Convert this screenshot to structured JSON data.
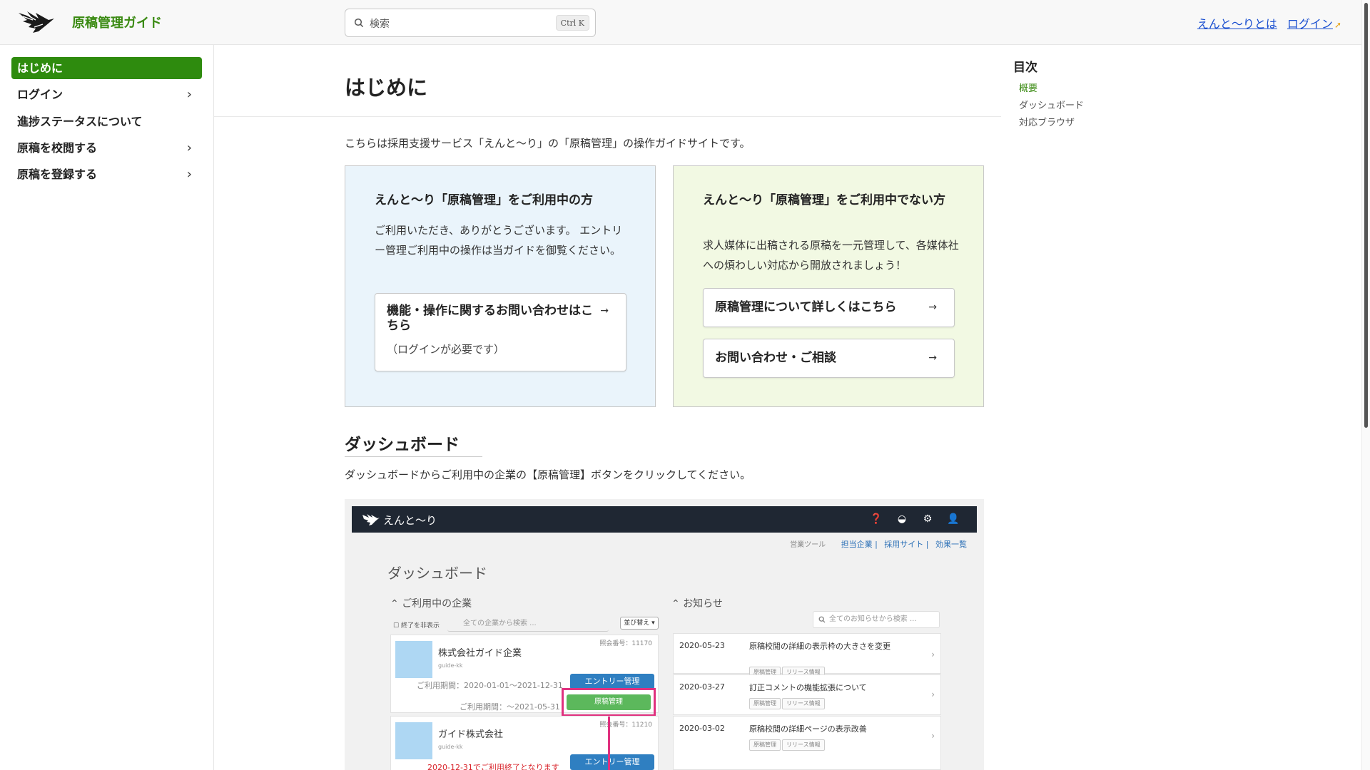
{
  "header": {
    "site_title": "原稿管理ガイド",
    "search_placeholder": "検索",
    "search_shortcut": "Ctrl K",
    "links": [
      "えんと〜りとは",
      "ログイン"
    ]
  },
  "sidebar": {
    "items": [
      {
        "label": "はじめに",
        "active": true,
        "has_children": false
      },
      {
        "label": "ログイン",
        "active": false,
        "has_children": true
      },
      {
        "label": "進捗ステータスについて",
        "active": false,
        "has_children": false
      },
      {
        "label": "原稿を校閲する",
        "active": false,
        "has_children": true
      },
      {
        "label": "原稿を登録する",
        "active": false,
        "has_children": true
      }
    ],
    "chevron": "›"
  },
  "main": {
    "title": "はじめに",
    "intro": "こちらは採用支援サービス「えんと〜り」の「原稿管理」の操作ガイドサイトです。",
    "card_users": {
      "heading": "えんと〜り「原稿管理」をご利用中の方",
      "body": "ご利用いただき、ありがとうございます。 エントリー管理ご利用中の操作は当ガイドを御覧ください。",
      "link_label": "機能・操作に関するお問い合わせはこちら",
      "link_sub": "（ログインが必要です）"
    },
    "card_nonusers": {
      "heading": "えんと〜り「原稿管理」をご利用中でない方",
      "body": "求人媒体に出稿される原稿を一元管理して、各媒体社への煩わしい対応から開放されましょう！",
      "link1_label": "原稿管理について詳しくはこちら",
      "link2_label": "お問い合わせ・ご相談"
    },
    "arrow": "→",
    "dashboard_section": {
      "title": "ダッシュボード",
      "text": "ダッシュボードからご利用中の企業の【原稿管理】ボタンをクリックしてください。"
    }
  },
  "screenshot": {
    "brand": "えんと〜り",
    "top_icons": [
      "help-icon",
      "dashboard-icon",
      "settings-icon",
      "user-icon"
    ],
    "sub_links_label": "営業ツール",
    "sub_links": [
      "担当企業",
      "採用サイト",
      "効果一覧"
    ],
    "dash_title": "ダッシュボード",
    "companies_head": "ご利用中の企業",
    "hide_finished": "終了を非表示",
    "company_search": "全ての企業から検索 ...",
    "sort_label": "並び替え",
    "companies": [
      {
        "name": "株式会社ガイド企業",
        "slug": "guide-kk",
        "number": "照会番号：11170",
        "period1": "ご利用期間：2020-01-01〜2021-12-31",
        "period2": "ご利用期間：〜2021-05-31",
        "btn_entry": "エントリー管理",
        "btn_manuscript": "原稿管理"
      },
      {
        "name": "ガイド株式会社",
        "slug": "guide-kk",
        "number": "照会番号：11210",
        "warning": "2020-12-31でご利用終了となります",
        "btn_entry": "エントリー管理"
      }
    ],
    "news_head": "お知らせ",
    "news_search": "全てのお知らせから検索 ...",
    "news": [
      {
        "date": "2020-05-23",
        "title": "原稿校閲の詳細の表示枠の大きさを変更",
        "tags": [
          "原稿管理",
          "リリース情報"
        ]
      },
      {
        "date": "2020-03-27",
        "title": "訂正コメントの機能拡張について",
        "tags": [
          "原稿管理",
          "リリース情報"
        ]
      },
      {
        "date": "2020-03-02",
        "title": "原稿校閲の詳細ページの表示改善",
        "tags": [
          "原稿管理",
          "リリース情報"
        ]
      }
    ]
  },
  "toc": {
    "title": "目次",
    "items": [
      {
        "label": "概要",
        "active": true
      },
      {
        "label": "ダッシュボード",
        "active": false
      },
      {
        "label": "対応ブラウザ",
        "active": false
      }
    ]
  },
  "colors": {
    "brand_green": "#2e8b0e",
    "link_blue": "#1a4fd0",
    "card_blue_bg": "#eaf4fb",
    "card_green_bg": "#f2f9e3",
    "highlight_pink": "#e0317f"
  }
}
